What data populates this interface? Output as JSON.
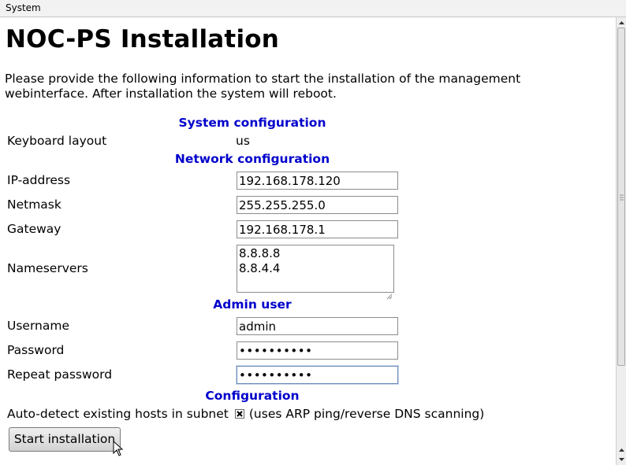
{
  "menubar": {
    "system_menu": "System"
  },
  "page": {
    "title": "NOC-PS Installation",
    "intro": "Please provide the following information to start the installation of the management webinterface. After installation the system will reboot."
  },
  "system_configuration": {
    "heading": "System configuration",
    "keyboard_layout_label": "Keyboard layout",
    "keyboard_layout_value": "us"
  },
  "network_configuration": {
    "heading": "Network configuration",
    "ip_label": "IP-address",
    "ip_value": "192.168.178.120",
    "netmask_label": "Netmask",
    "netmask_value": "255.255.255.0",
    "gateway_label": "Gateway",
    "gateway_value": "192.168.178.1",
    "nameservers_label": "Nameservers",
    "nameservers_value": "8.8.8.8\n8.8.4.4"
  },
  "admin_user": {
    "heading": "Admin user",
    "username_label": "Username",
    "username_value": "admin",
    "password_label": "Password",
    "password_value": "••••••••••",
    "repeat_password_label": "Repeat password",
    "repeat_password_value": "••••••••••"
  },
  "configuration": {
    "heading": "Configuration",
    "autodetect_label": "Auto-detect existing hosts in subnet",
    "autodetect_checked": true,
    "autodetect_note": "(uses ARP ping/reverse DNS scanning)"
  },
  "actions": {
    "start_installation": "Start installation"
  },
  "icons": {
    "checkbox_mark": "x-mark-icon",
    "cursor": "mouse-pointer-icon"
  }
}
